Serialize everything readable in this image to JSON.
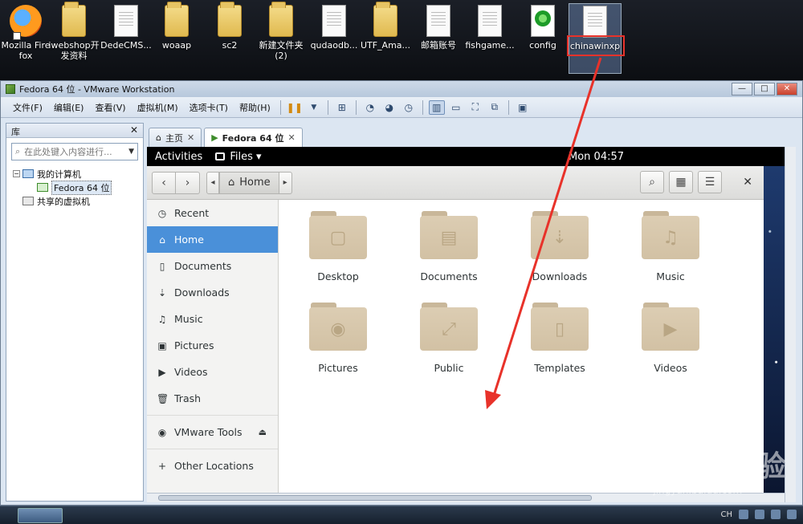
{
  "desktop": {
    "icons": [
      {
        "label": "Mozilla Firefox",
        "icon": "firefox-icon",
        "type": "firefox"
      },
      {
        "label": "iwebshop开发资料",
        "icon": "folder-icon",
        "type": "folder"
      },
      {
        "label": "DedeCMS...",
        "icon": "file-icon",
        "type": "file"
      },
      {
        "label": "woaap",
        "icon": "folder-icon",
        "type": "folder"
      },
      {
        "label": "sc2",
        "icon": "folder-icon",
        "type": "folder"
      },
      {
        "label": "新建文件夹 (2)",
        "icon": "folder-icon",
        "type": "folder"
      },
      {
        "label": "qudaodb...",
        "icon": "file-icon",
        "type": "file"
      },
      {
        "label": "UTF_Ama...",
        "icon": "folder-icon",
        "type": "folder"
      },
      {
        "label": "邮箱账号",
        "icon": "file-icon",
        "type": "file"
      },
      {
        "label": "fishgame...",
        "icon": "file-icon",
        "type": "file"
      },
      {
        "label": "config",
        "icon": "config-icon",
        "type": "config"
      },
      {
        "label": "chinawinxp",
        "icon": "file-icon",
        "type": "file"
      }
    ]
  },
  "vmware": {
    "title": "Fedora 64 位 - VMware Workstation",
    "window_controls": [
      "—",
      "□",
      "✕"
    ],
    "menu": [
      "文件(F)",
      "编辑(E)",
      "查看(V)",
      "虚拟机(M)",
      "选项卡(T)",
      "帮助(H)"
    ],
    "library": {
      "title": "库",
      "close": "✕",
      "search_placeholder": "在此处键入内容进行...",
      "tree": {
        "my_computer": "我的计算机",
        "vm": "Fedora 64 位",
        "shared": "共享的虚拟机"
      }
    },
    "tabs": [
      {
        "label": "主页",
        "close": "✕"
      },
      {
        "label": "Fedora 64 位",
        "close": "✕"
      }
    ]
  },
  "gnome": {
    "activities": "Activities",
    "app_menu": "Files ▾",
    "clock": "Mon 04:57"
  },
  "nautilus": {
    "path_label": "Home",
    "sidebar": [
      {
        "label": "Recent",
        "icon": "clock-icon",
        "glyph": "◷"
      },
      {
        "label": "Home",
        "icon": "home-icon",
        "glyph": "⌂",
        "active": true
      },
      {
        "label": "Documents",
        "icon": "document-icon",
        "glyph": "▯"
      },
      {
        "label": "Downloads",
        "icon": "download-icon",
        "glyph": "⇣"
      },
      {
        "label": "Music",
        "icon": "music-icon",
        "glyph": "♫"
      },
      {
        "label": "Pictures",
        "icon": "camera-icon",
        "glyph": "▣"
      },
      {
        "label": "Videos",
        "icon": "video-icon",
        "glyph": "▶"
      },
      {
        "label": "Trash",
        "icon": "trash-icon",
        "glyph": "🗑"
      }
    ],
    "devices": {
      "label": "VMware Tools",
      "eject": "⏏"
    },
    "other": {
      "label": "Other Locations",
      "glyph": "+"
    },
    "folders": [
      {
        "label": "Desktop",
        "icon": "desktop-folder-icon",
        "glyph": "▢"
      },
      {
        "label": "Documents",
        "icon": "documents-folder-icon",
        "glyph": "▤"
      },
      {
        "label": "Downloads",
        "icon": "downloads-folder-icon",
        "glyph": "⇣"
      },
      {
        "label": "Music",
        "icon": "music-folder-icon",
        "glyph": "♫"
      },
      {
        "label": "Pictures",
        "icon": "pictures-folder-icon",
        "glyph": "◉"
      },
      {
        "label": "Public",
        "icon": "public-folder-icon",
        "glyph": "⤢"
      },
      {
        "label": "Templates",
        "icon": "templates-folder-icon",
        "glyph": "▯"
      },
      {
        "label": "Videos",
        "icon": "videos-folder-icon",
        "glyph": "▶"
      }
    ]
  },
  "taskbar": {
    "lang": "CH"
  },
  "watermark": {
    "brand": "Bai du 经验",
    "url": "jingyan.baidu.com"
  },
  "colors": {
    "accent": "#4a90d9",
    "annotation": "#e8322a"
  }
}
